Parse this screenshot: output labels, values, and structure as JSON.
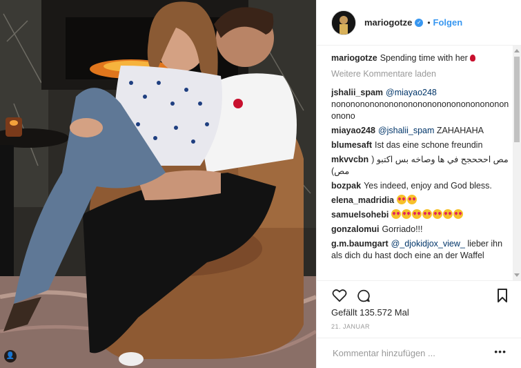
{
  "post": {
    "username": "mariogotze",
    "follow_label": "Folgen",
    "dot": "•"
  },
  "caption": {
    "user": "mariogotze",
    "text": "Spending time with her"
  },
  "load_more": "Weitere Kommentare laden",
  "comments": [
    {
      "user": "jshalii_spam",
      "mention": "@miayao248",
      "text": "nonononononononononononononononononononono"
    },
    {
      "user": "miayao248",
      "mention": "@jshalii_spam",
      "text": "ZAHAHAHA"
    },
    {
      "user": "blumesaft",
      "mention": "",
      "text": "Ist das eine schone freundin"
    },
    {
      "user": "mkvvcbn",
      "mention": "",
      "text": "مص احححجح في ها وصاخه بس اكتبو ( مص)"
    },
    {
      "user": "bozpak",
      "mention": "",
      "text": "Yes indeed, enjoy and God bless."
    },
    {
      "user": "elena_madridia",
      "mention": "",
      "text": ""
    },
    {
      "user": "samuelsohebi",
      "mention": "",
      "text": ""
    },
    {
      "user": "gonzalomui",
      "mention": "",
      "text": "Gorriado!!!"
    },
    {
      "user": "g.m.baumgart",
      "mention": "@_djokidjox_view_",
      "text": "lieber ihn als dich du hast doch eine an der Waffel"
    }
  ],
  "emoji_counts": {
    "elena_madridia": 2,
    "samuelsohebi": 7
  },
  "likes": "Gefällt 135.572 Mal",
  "date": "21. JANUAR",
  "add_comment_placeholder": "Kommentar hinzufügen ...",
  "more_label": "•••",
  "colors": {
    "accent": "#3897f0",
    "mention": "#003569",
    "muted": "#999999"
  },
  "icons": [
    "verified-icon",
    "heart-icon",
    "comment-icon",
    "bookmark-icon",
    "more-options-icon",
    "user-tag-icon"
  ]
}
